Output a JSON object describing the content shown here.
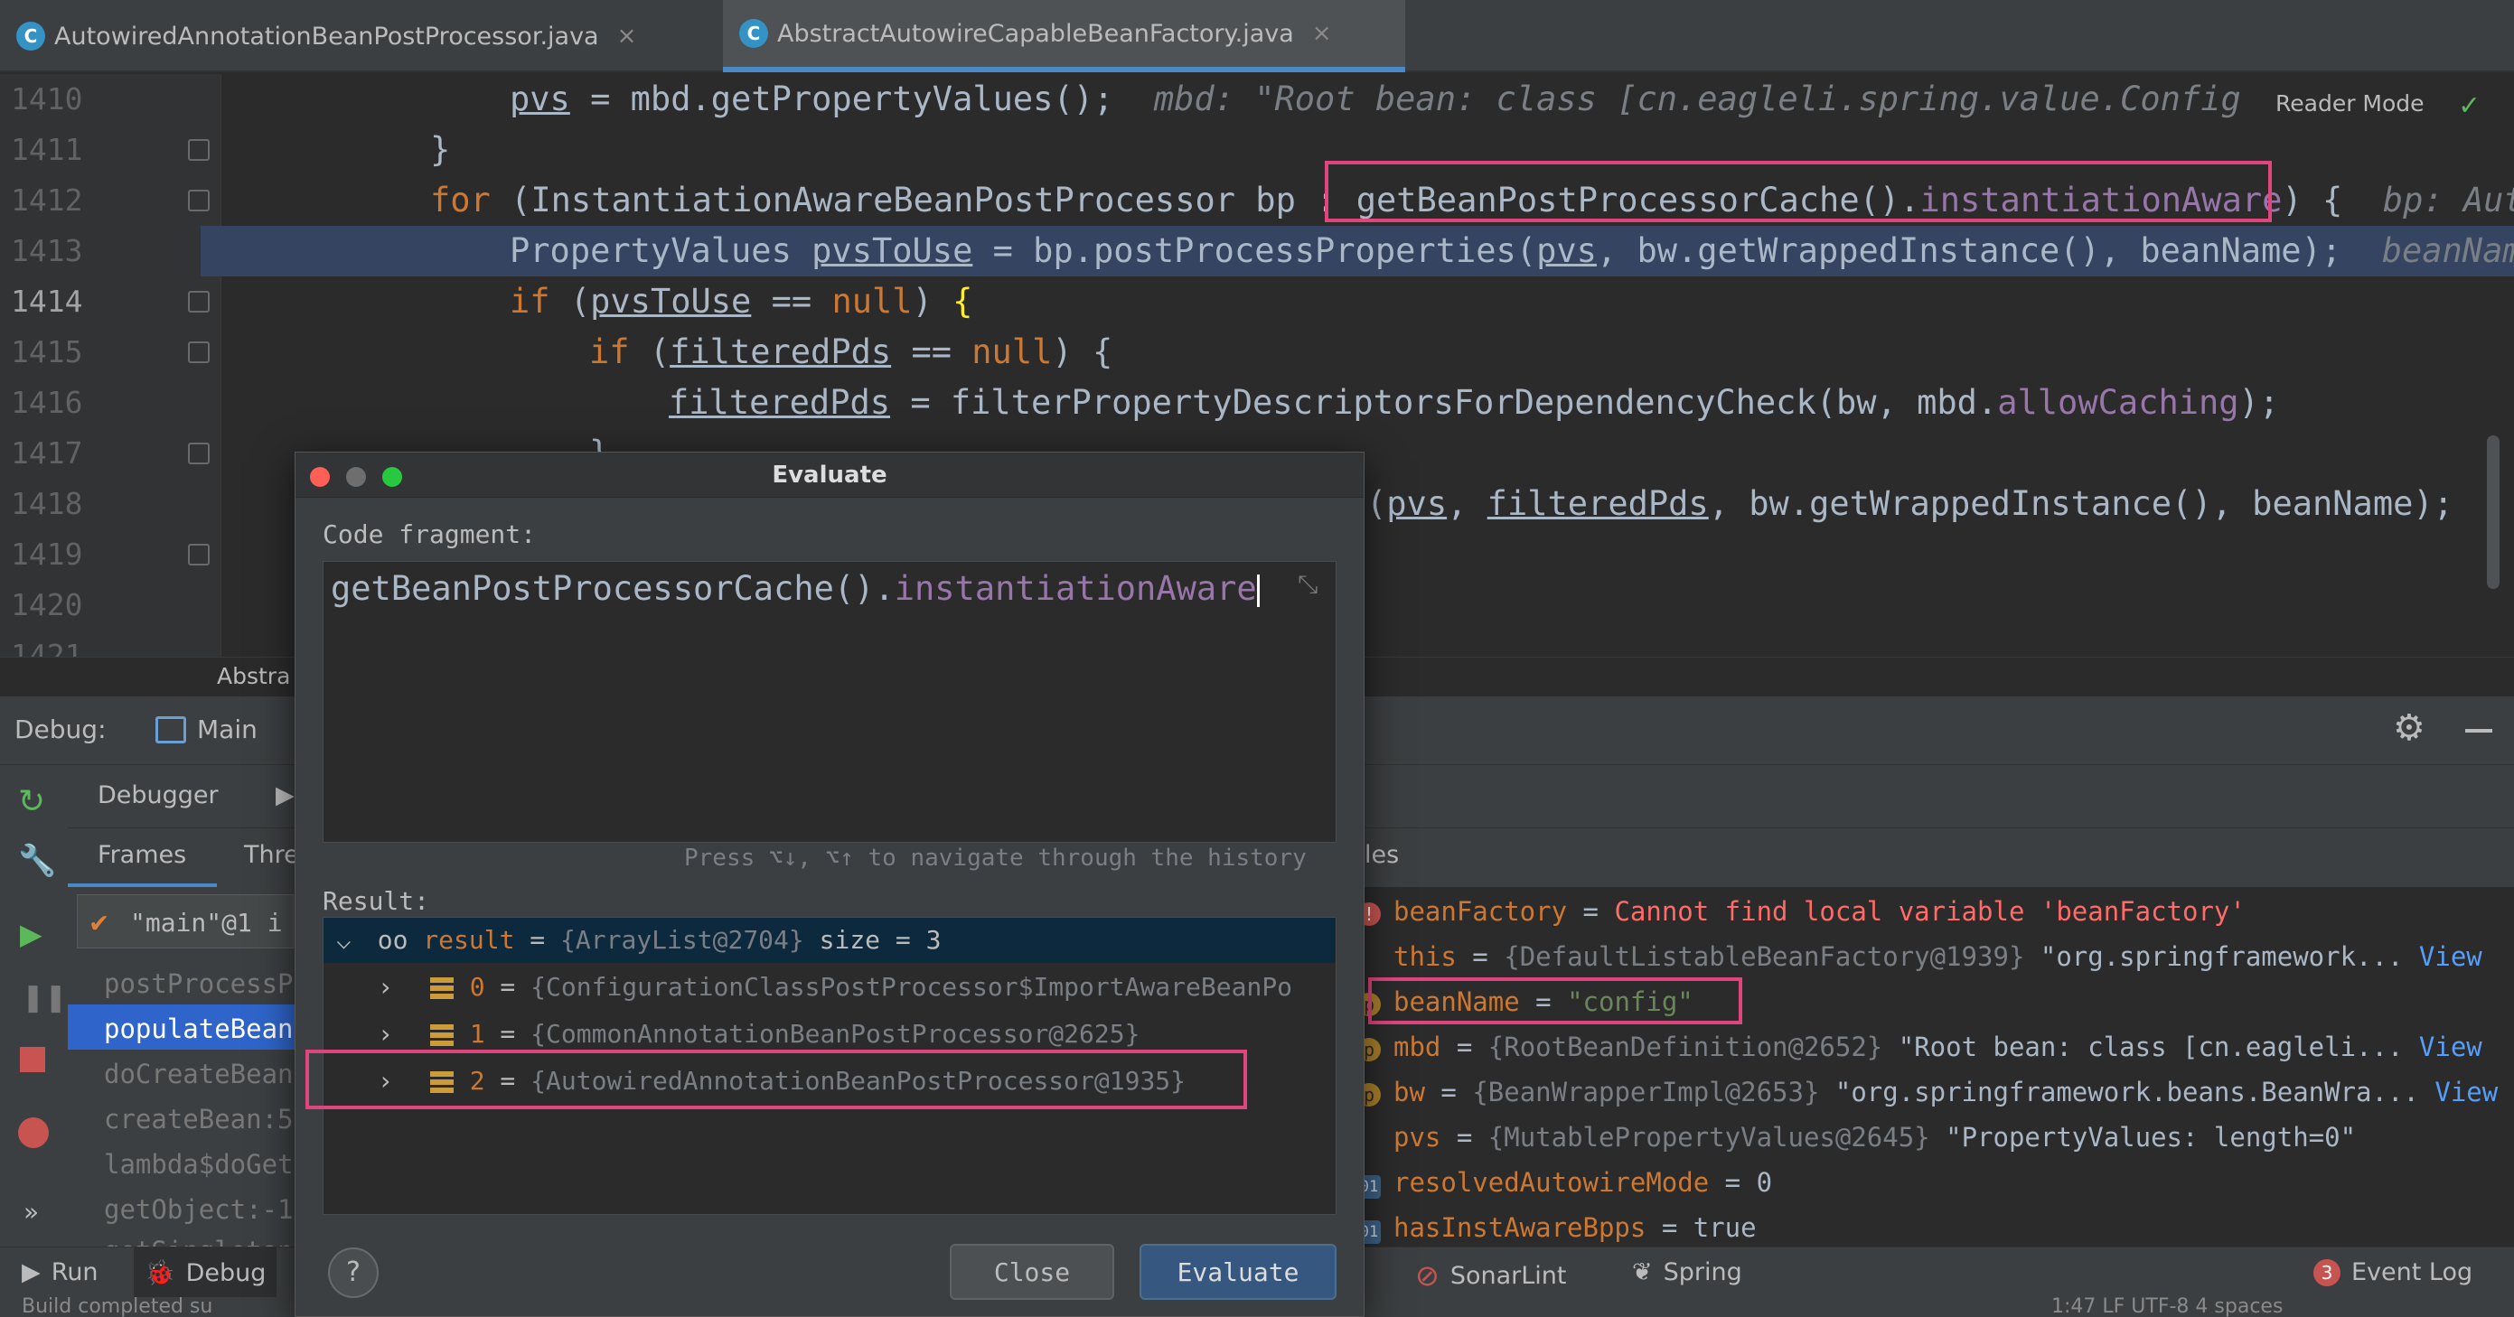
{
  "tabs": [
    {
      "label": "AutowiredAnnotationBeanPostProcessor.java",
      "icon": "c-class-icon"
    },
    {
      "label": "AbstractAutowireCapableBeanFactory.java",
      "icon": "c-class-icon"
    }
  ],
  "editor": {
    "reader_mode": "Reader Mode",
    "breadcrumb": "Abstra",
    "line_numbers": [
      "1410",
      "1411",
      "1412",
      "1413",
      "1414",
      "1415",
      "1416",
      "1417",
      "1418",
      "1419",
      "1420",
      "1421"
    ],
    "lines": {
      "l1410": {
        "a": "pvs",
        "b": " = mbd.getPropertyValues();",
        "hint": "mbd: \"Root bean: class [cn.eagleli.spring.value.Config"
      },
      "l1411": "}",
      "l1412": {
        "kw": "for",
        "a": " (InstantiationAwareBeanPostProcessor bp : ",
        "b": "getBeanPostProcessorCache().",
        "c": "instantiationAware",
        "d": ") {",
        "hint": "bp: Auto"
      },
      "l1413": {
        "a": "PropertyValues ",
        "b": "pvsToUse",
        "c": " = bp.postProcessProperties(",
        "d": "pvs",
        "e": ", bw.getWrappedInstance(), beanName);",
        "hint": "beanName"
      },
      "l1414": {
        "kw": "if",
        "a": " (",
        "b": "pvsToUse",
        "c": " == ",
        "d": "null",
        "e": ") ",
        "f": "{"
      },
      "l1415": {
        "kw": "if",
        "a": " (",
        "b": "filteredPds",
        "c": " == ",
        "d": "null",
        "e": ") {"
      },
      "l1416": {
        "a": "filteredPds",
        "b": " = filterPropertyDescriptorsForDependencyCheck(bw, mbd.",
        "c": "allowCaching",
        "d": ");"
      },
      "l1417": "}",
      "l1418": {
        "a": "(",
        "b": "pvs",
        "c": ", ",
        "d": "filteredPds",
        "e": ", bw.getWrappedInstance(), beanName);"
      }
    }
  },
  "debug": {
    "label": "Debug:",
    "session": "Main",
    "debugger_tab": "Debugger",
    "frames_tab": "Frames",
    "threads_tab": "Thre",
    "thread_selector": "\"main\"@1 i",
    "frames": [
      "postProcessP",
      "populateBean",
      "doCreateBean",
      "createBean:5",
      "lambda$doGet",
      "getObject:-1",
      "getSingleton"
    ],
    "variables_header": "les",
    "variables": [
      {
        "name": "beanFactory",
        "eq": " = ",
        "value": "Cannot find local variable 'beanFactory'",
        "badge": "!"
      },
      {
        "name": "this",
        "eq": " = ",
        "value": "{DefaultListableBeanFactory@1939}",
        "extra": " \"org.springframework...",
        "link": "View"
      },
      {
        "name": "beanName",
        "eq": " = ",
        "value": "\"config\"",
        "badge": "p"
      },
      {
        "name": "mbd",
        "eq": " = ",
        "value": "{RootBeanDefinition@2652}",
        "extra": " \"Root bean: class [cn.eagleli...",
        "link": "View",
        "badge": "p"
      },
      {
        "name": "bw",
        "eq": " = ",
        "value": "{BeanWrapperImpl@2653}",
        "extra": " \"org.springframework.beans.BeanWra...",
        "link": "View",
        "badge": "p"
      },
      {
        "name": "pvs",
        "eq": " = ",
        "value": "{MutablePropertyValues@2645}",
        "extra": " \"PropertyValues: length=0\""
      },
      {
        "name": "resolvedAutowireMode",
        "eq": " = ",
        "value": "0",
        "badge": "01"
      },
      {
        "name": "hasInstAwareBpps",
        "eq": " = ",
        "value": "true",
        "badge": "01"
      }
    ]
  },
  "bottom": {
    "run": "Run",
    "debug": "Debug",
    "sonarlint": "SonarLint",
    "spring": "Spring",
    "event_log": "Event Log",
    "event_count": "3",
    "status_left": "Build completed su",
    "status_right": "1:47  LF  UTF-8  4 spaces"
  },
  "dialog": {
    "title": "Evaluate",
    "code_label": "Code fragment:",
    "code_a": "getBeanPostProcessorCache().",
    "code_b": "instantiationAware",
    "history_hint": "Press ⌥↓, ⌥↑ to navigate through the history",
    "result_label": "Result:",
    "result": {
      "name": "result",
      "eq": " = ",
      "value": "{ArrayList@2704}",
      "size": "  size = 3"
    },
    "items": [
      {
        "idx": "0",
        "eq": " = ",
        "value": "{ConfigurationClassPostProcessor$ImportAwareBeanPo"
      },
      {
        "idx": "1",
        "eq": " = ",
        "value": "{CommonAnnotationBeanPostProcessor@2625}"
      },
      {
        "idx": "2",
        "eq": " = ",
        "value": "{AutowiredAnnotationBeanPostProcessor@1935}"
      }
    ],
    "help": "?",
    "close": "Close",
    "evaluate": "Evaluate"
  },
  "colors": {
    "highlight_box": "#e0467e",
    "accent": "#4a88c7",
    "selection": "#2f65ca"
  }
}
